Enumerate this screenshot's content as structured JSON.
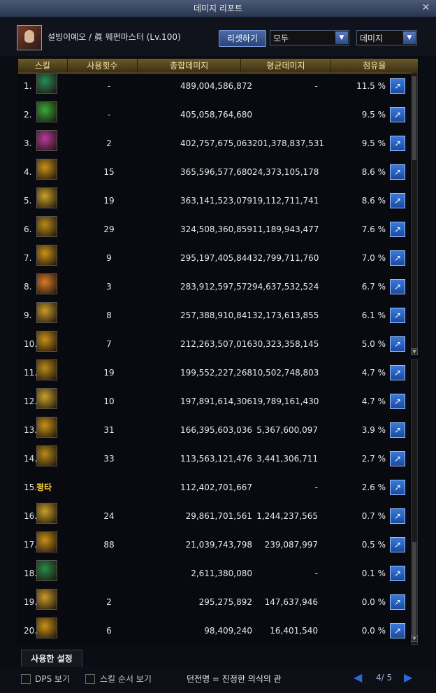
{
  "window": {
    "title": "데미지 리포트"
  },
  "header": {
    "character": "설빙이예오 / 眞 웨펀마스터 (Lv.100)",
    "reset_label": "리셋하기",
    "filter_select": "모두",
    "metric_select": "데미지"
  },
  "columns": {
    "skill": "스킬",
    "uses": "사용횟수",
    "total": "총합데미지",
    "avg": "평균데미지",
    "share": "점유율"
  },
  "rows": [
    {
      "rank": "1.",
      "uses": "-",
      "total": "489,004,586,872",
      "avg": "-",
      "share": "11.5 %",
      "icon": "skill-icon",
      "color": "#2a8a5a"
    },
    {
      "rank": "2.",
      "uses": "-",
      "total": "405,058,764,680",
      "avg": "",
      "share": "9.5 %",
      "icon": "skill-icon",
      "color": "#3aa83a"
    },
    {
      "rank": "3.",
      "uses": "2",
      "total": "402,757,675,063",
      "avg": "201,378,837,531",
      "share": "9.5 %",
      "icon": "skill-icon",
      "color": "#b83aa0"
    },
    {
      "rank": "4.",
      "uses": "15",
      "total": "365,596,577,680",
      "avg": "24,373,105,178",
      "share": "8.6 %",
      "icon": "skill-icon",
      "color": "#c8901a"
    },
    {
      "rank": "5.",
      "uses": "19",
      "total": "363,141,523,079",
      "avg": "19,112,711,741",
      "share": "8.6 %",
      "icon": "skill-icon",
      "color": "#c8a02a"
    },
    {
      "rank": "6.",
      "uses": "29",
      "total": "324,508,360,859",
      "avg": "11,189,943,477",
      "share": "7.6 %",
      "icon": "skill-icon",
      "color": "#b88a1a"
    },
    {
      "rank": "7.",
      "uses": "9",
      "total": "295,197,405,844",
      "avg": "32,799,711,760",
      "share": "7.0 %",
      "icon": "skill-icon",
      "color": "#c8901a"
    },
    {
      "rank": "8.",
      "uses": "3",
      "total": "283,912,597,572",
      "avg": "94,637,532,524",
      "share": "6.7 %",
      "icon": "skill-icon",
      "color": "#d87a2a"
    },
    {
      "rank": "9.",
      "uses": "8",
      "total": "257,388,910,841",
      "avg": "32,173,613,855",
      "share": "6.1 %",
      "icon": "skill-icon",
      "color": "#c89a2a"
    },
    {
      "rank": "10.",
      "uses": "7",
      "total": "212,263,507,016",
      "avg": "30,323,358,145",
      "share": "5.0 %",
      "icon": "skill-icon",
      "color": "#c8901a"
    },
    {
      "rank": "11.",
      "uses": "19",
      "total": "199,552,227,268",
      "avg": "10,502,748,803",
      "share": "4.7 %",
      "icon": "skill-icon",
      "color": "#b88a1a"
    },
    {
      "rank": "12.",
      "uses": "10",
      "total": "197,891,614,306",
      "avg": "19,789,161,430",
      "share": "4.7 %",
      "icon": "skill-icon",
      "color": "#c8a02a"
    },
    {
      "rank": "13.",
      "uses": "31",
      "total": "166,395,603,036",
      "avg": "5,367,600,097",
      "share": "3.9 %",
      "icon": "skill-icon",
      "color": "#c8901a"
    },
    {
      "rank": "14.",
      "uses": "33",
      "total": "113,563,121,476",
      "avg": "3,441,306,711",
      "share": "2.7 %",
      "icon": "skill-icon",
      "color": "#b88a1a"
    },
    {
      "rank": "15.",
      "uses": "",
      "total": "112,402,701,667",
      "avg": "-",
      "share": "2.6 %",
      "text": "평타"
    },
    {
      "rank": "16.",
      "uses": "24",
      "total": "29,861,701,561",
      "avg": "1,244,237,565",
      "share": "0.7 %",
      "icon": "skill-icon",
      "color": "#c8a02a"
    },
    {
      "rank": "17.",
      "uses": "88",
      "total": "21,039,743,798",
      "avg": "239,087,997",
      "share": "0.5 %",
      "icon": "skill-icon",
      "color": "#c8901a"
    },
    {
      "rank": "18.",
      "uses": "",
      "total": "2,611,380,080",
      "avg": "-",
      "share": "0.1 %",
      "icon": "skill-icon",
      "color": "#2a8a4a"
    },
    {
      "rank": "19.",
      "uses": "2",
      "total": "295,275,892",
      "avg": "147,637,946",
      "share": "0.0 %",
      "icon": "skill-icon",
      "color": "#c89a2a"
    },
    {
      "rank": "20.",
      "uses": "6",
      "total": "98,409,240",
      "avg": "16,401,540",
      "share": "0.0 %",
      "icon": "skill-icon",
      "color": "#c8901a"
    }
  ],
  "tab": {
    "label": "사용한 설정"
  },
  "footer": {
    "dps_label": "DPS 보기",
    "skill_order_label": "스킬 순서 보기",
    "dungeon": "던전명 = 진정한 의식의 관",
    "page": "4/ 5"
  }
}
